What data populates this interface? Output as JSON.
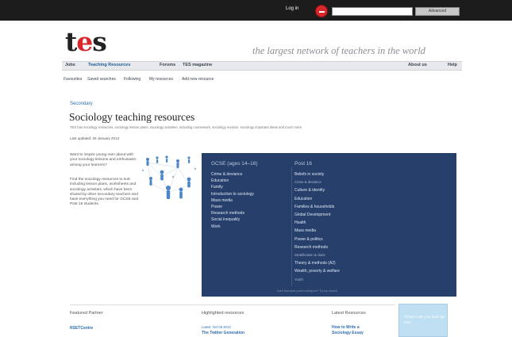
{
  "topbar": {
    "login_label": "Log in",
    "search_placeholder": "",
    "search_button": "Advanced"
  },
  "brand": {
    "logo_t": "t",
    "logo_e": "e",
    "logo_s": "s",
    "tagline": "the largest network of teachers in the world"
  },
  "nav": {
    "items": [
      "Jobs",
      "Teaching Resources",
      "Forums",
      "TES magazine"
    ],
    "right_items": [
      "About us",
      "Help"
    ]
  },
  "subnav": {
    "items": [
      "Favourites",
      "Saved searches",
      "Following",
      "My resources",
      "Add new resource"
    ]
  },
  "page": {
    "breadcrumb": "Secondary",
    "title": "Sociology teaching resources",
    "keywords": "TES has sociology resources, sociology lesson plans, sociology activities, including coursework, sociology revision, sociology important ideas and much more",
    "updated": "Last updated: 25 January 2013"
  },
  "intro": {
    "para1": "Want to inspire young men about with your sociology lessons and enthusiasm among your learners?",
    "para2": "Find the sociology resources to suit: including lesson plans, worksheets and sociology activities, which have been shared by other secondary teachers and have everything you need for GCSE and Post 16 students."
  },
  "panel": {
    "col1_head": "GCSE (ages 14–16)",
    "col1_links": [
      "Crime & deviance",
      "Education",
      "Family",
      "Introduction to sociology",
      "Mass media",
      "Power",
      "Research methods",
      "Social inequality",
      "Work"
    ],
    "col2_head": "Post 16",
    "col2_links": [
      {
        "label": "Beliefs in society",
        "dim": false
      },
      {
        "label": "Crime & deviance",
        "dim": true
      },
      {
        "label": "Culture & identity",
        "dim": false
      },
      {
        "label": "Education",
        "dim": false
      },
      {
        "label": "Families & households",
        "dim": false
      },
      {
        "label": "Global Development",
        "dim": false
      },
      {
        "label": "Health",
        "dim": false
      },
      {
        "label": "Mass media",
        "dim": false
      },
      {
        "label": "Power & politics",
        "dim": false
      },
      {
        "label": "Research methods",
        "dim": false
      },
      {
        "label": "Stratification & class",
        "dim": true
      },
      {
        "label": "Theory & methods (A2)",
        "dim": false
      },
      {
        "label": "Wealth, poverty & welfare",
        "dim": false
      },
      {
        "label": "Youth",
        "dim": true
      }
    ],
    "footer": "Can't find what you're looking for? Try our search"
  },
  "bottom": {
    "featured_head": "Featured Partner",
    "featured_link": "RSETCentre",
    "highlighted_head": "Highlighted resources",
    "highlighted_small": "Latest: Oct 05 2013",
    "highlighted_link": "The Twitter Generation",
    "latest_head": "Latest Resources",
    "latest_link1": "How to Write a",
    "latest_link2": "Sociology Essay",
    "ad_text": "Where can you find the best"
  }
}
